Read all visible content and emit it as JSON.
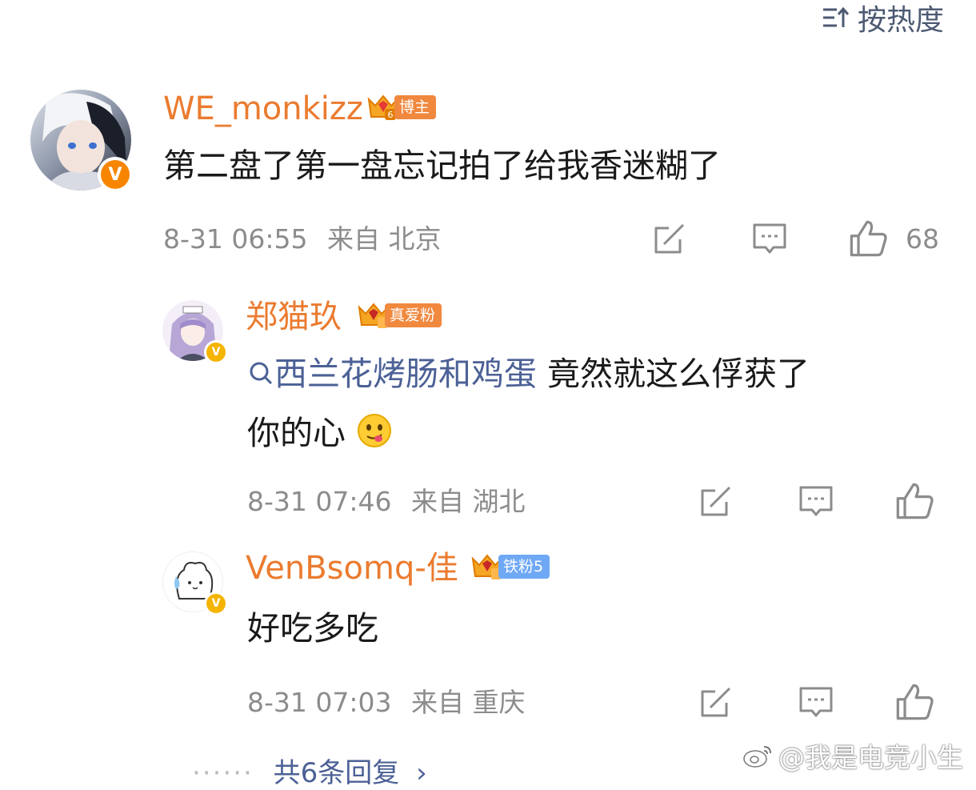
{
  "sort": {
    "label": "按热度"
  },
  "comment": {
    "username": "WE_monkizz",
    "badge": "博主",
    "badge_level": "6",
    "text": "第二盘了第一盘忘记拍了给我香迷糊了",
    "time": "8-31 06:55",
    "location": "来自 北京",
    "likes": "68"
  },
  "replies": [
    {
      "username": "郑猫玖",
      "badge": "真爱粉",
      "topic": "西兰花烤肠和鸡蛋",
      "text_after_topic": " 竟然就这么俘获了",
      "text_line2": "你的心",
      "emoji": "drooling-face",
      "time": "8-31 07:46",
      "location": "来自 湖北"
    },
    {
      "username": "VenBsomq-佳",
      "badge": "铁粉5",
      "text": "好吃多吃",
      "time": "8-31 07:03",
      "location": "来自 重庆"
    }
  ],
  "more_replies": "共6条回复",
  "watermark": "@我是电竞小生",
  "colors": {
    "username": "#eb7b2f",
    "topic": "#4c6196",
    "meta": "#8c8c8c",
    "verified_orange": "#f78500",
    "verified_yellow": "#f5b400",
    "badge_orange": "#f0883e",
    "badge_blue": "#6fa8f5"
  }
}
